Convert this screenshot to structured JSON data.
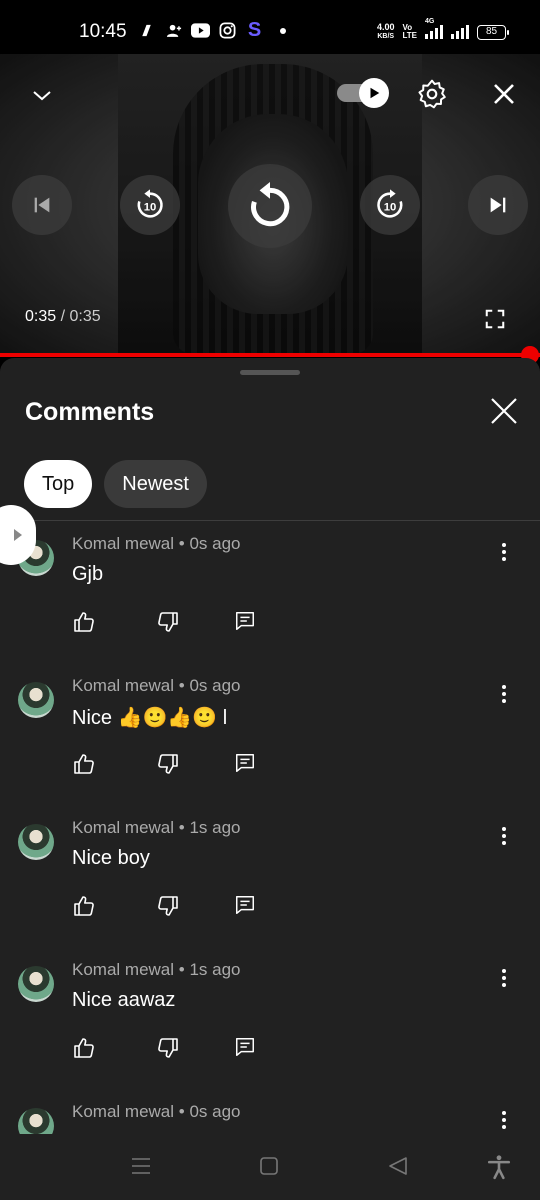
{
  "status_bar": {
    "time": "10:45",
    "icons": [
      "threads-icon",
      "contact-add-icon",
      "youtube-icon",
      "instagram-icon",
      "s-app-icon"
    ],
    "net_speed_value": "4.00",
    "net_speed_unit": "KB/S",
    "volte_top": "Vo",
    "volte_bottom": "LTE",
    "network": "4G",
    "battery": "85"
  },
  "player": {
    "current_time": "0:35",
    "separator": " / ",
    "duration": "0:35",
    "progress_fraction": 1.0,
    "autoplay_on": true
  },
  "comments_panel": {
    "title": "Comments",
    "tabs": [
      {
        "label": "Top",
        "active": true
      },
      {
        "label": "Newest",
        "active": false
      }
    ],
    "comments": [
      {
        "author": "Komal mewal",
        "time": "0s ago",
        "text": "Gjb"
      },
      {
        "author": "Komal mewal",
        "time": "0s ago",
        "text": "Nice 👍🙂👍🙂 l"
      },
      {
        "author": "Komal mewal",
        "time": "1s ago",
        "text": "Nice boy"
      },
      {
        "author": "Komal mewal",
        "time": "1s ago",
        "text": "Nice aawaz"
      },
      {
        "author": "Komal mewal",
        "time": "0s ago",
        "text": ""
      }
    ],
    "meta_separator": " • "
  },
  "colors": {
    "panel_bg": "#212121",
    "progress": "#ee0000",
    "chip_active_bg": "#ffffff",
    "chip_bg": "#3a3a3a"
  }
}
